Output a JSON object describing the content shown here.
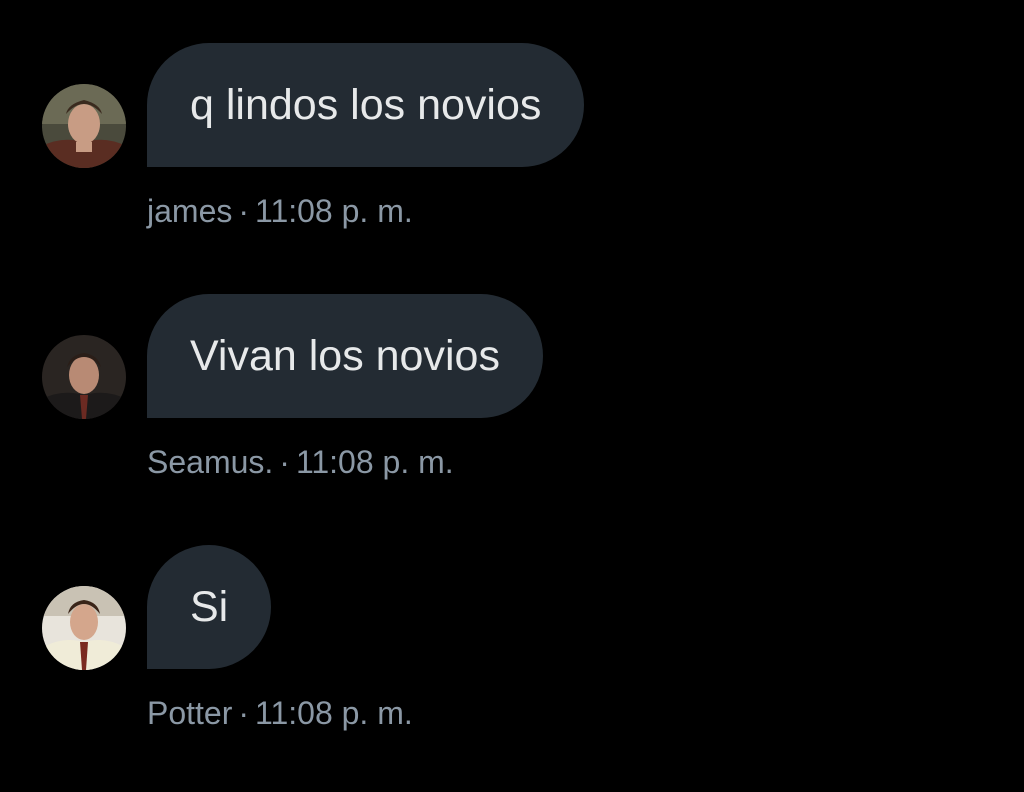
{
  "messages": [
    {
      "text": "q lindos los novios",
      "sender": "james",
      "separator": "·",
      "time": "11:08 p. m.",
      "avatar_icon": "avatar-photo-icon"
    },
    {
      "text": "Vivan los novios",
      "sender": "Seamus.",
      "separator": "·",
      "time": "11:08 p. m.",
      "avatar_icon": "avatar-photo-icon"
    },
    {
      "text": "Si",
      "sender": "Potter",
      "separator": "·",
      "time": "11:08 p. m.",
      "avatar_icon": "avatar-photo-icon"
    }
  ],
  "colors": {
    "background": "#000000",
    "bubble": "#232b33",
    "bubble_text": "#e7e9ea",
    "meta_text": "#8b98a5"
  }
}
